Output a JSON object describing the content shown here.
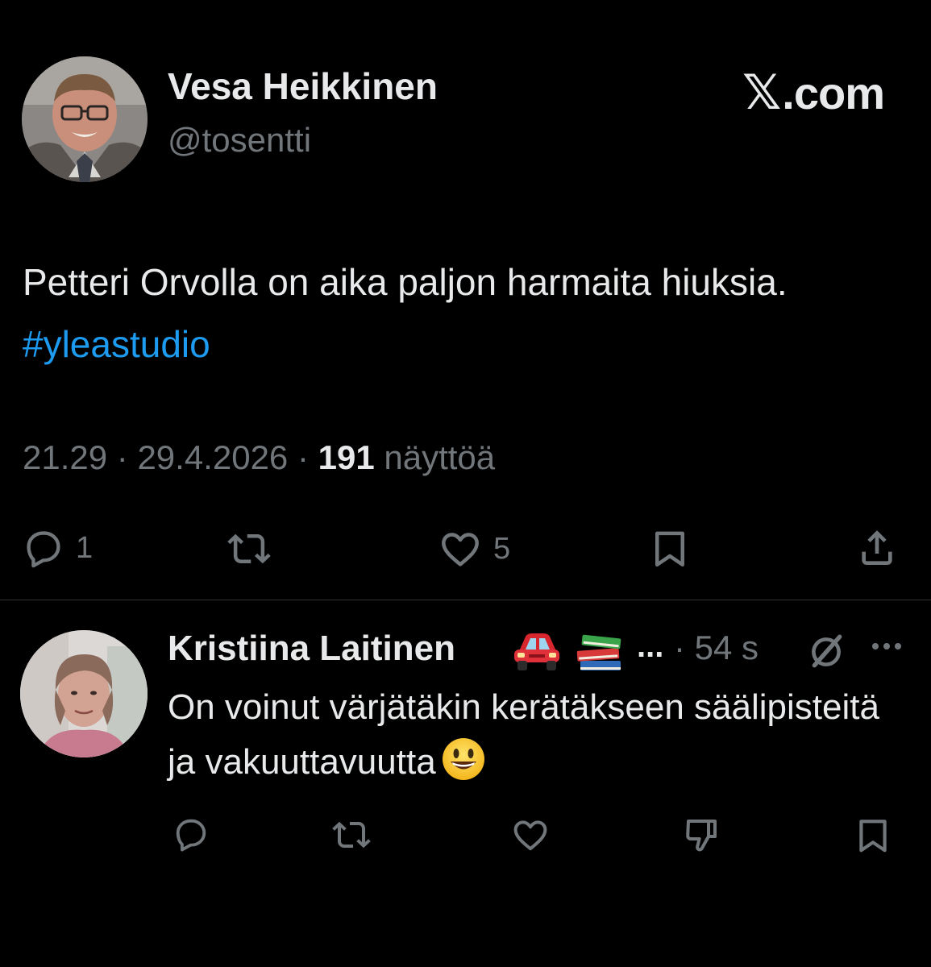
{
  "tweet": {
    "author_name": "Vesa Heikkinen",
    "author_handle": "@tosentti",
    "site_label": ".com",
    "site_logo_glyph": "𝕏",
    "text_main": "Petteri Orvolla on aika paljon harmaita hiuksia. ",
    "hashtag": "#yleastudio",
    "time": "21.29",
    "date": "29.4.2026",
    "views_count": "191",
    "views_label": "näyttöä",
    "separator": " · ",
    "actions": {
      "reply_count": "1",
      "like_count": "5",
      "icons": [
        "reply-icon",
        "retweet-icon",
        "like-icon",
        "bookmark-icon",
        "share-icon"
      ]
    }
  },
  "reply": {
    "author_name": "Kristiina Laitinen",
    "author_emojis": [
      "car-emoji",
      "books-emoji"
    ],
    "name_ellipsis": "...",
    "time": "· 54 s",
    "text": "On voinut värjätäkin kerätäkseen säälipisteitä ja vakuuttavuutta",
    "icons": [
      "reply-icon",
      "retweet-icon",
      "like-icon",
      "dislike-icon",
      "bookmark-icon",
      "grok-icon",
      "more-icon"
    ]
  },
  "colors": {
    "background": "#000000",
    "text_primary": "#e7e9ea",
    "text_secondary": "#71767b",
    "link": "#1d9bf0",
    "divider": "#2f3336"
  }
}
